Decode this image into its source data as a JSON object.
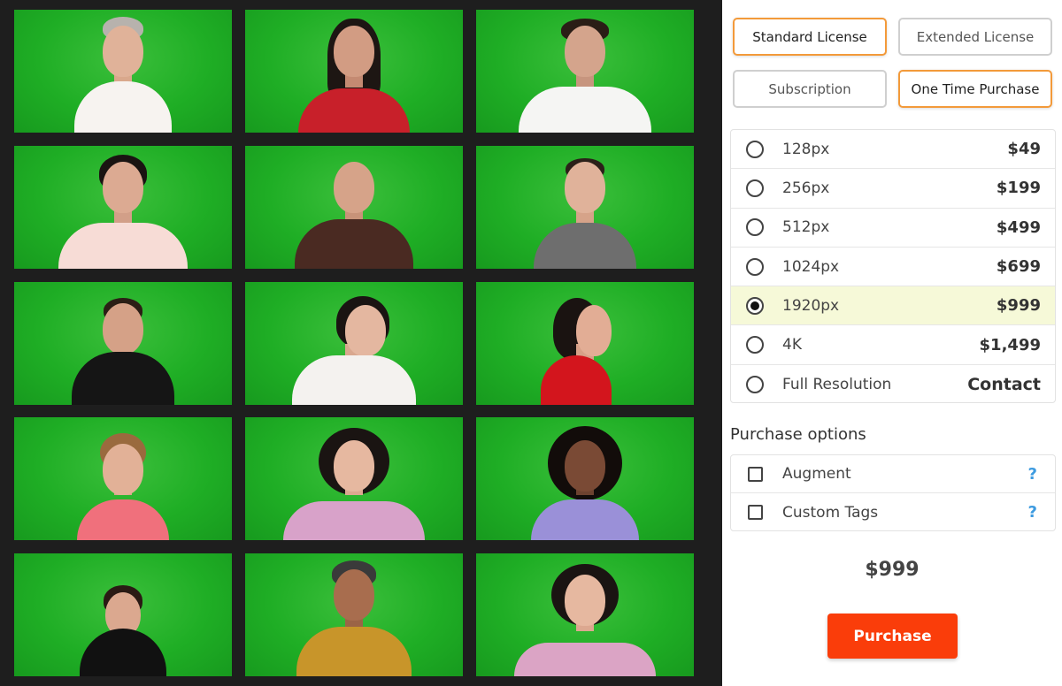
{
  "license_type": {
    "standard": "Standard License",
    "extended": "Extended License",
    "selected": "Standard License"
  },
  "purchase_type": {
    "subscription": "Subscription",
    "one_time": "One Time Purchase",
    "selected": "One Time Purchase"
  },
  "sizes": [
    {
      "label": "128px",
      "price": "$49"
    },
    {
      "label": "256px",
      "price": "$199"
    },
    {
      "label": "512px",
      "price": "$499"
    },
    {
      "label": "1024px",
      "price": "$699"
    },
    {
      "label": "1920px",
      "price": "$999"
    },
    {
      "label": "4K",
      "price": "$1,499"
    },
    {
      "label": "Full Resolution",
      "price": "Contact"
    }
  ],
  "selected_size": "1920px",
  "purchase_options": {
    "title": "Purchase options",
    "items": [
      {
        "label": "Augment",
        "checked": false,
        "help": "?"
      },
      {
        "label": "Custom Tags",
        "checked": false,
        "help": "?"
      }
    ]
  },
  "total": "$999",
  "purchase_button": "Purchase",
  "colors": {
    "accent_orange": "#f39a3a",
    "purchase_red": "#fa3d0a",
    "selected_row": "#f6f9d8",
    "help_blue": "#3d9be0",
    "green_screen": "#1fae25"
  }
}
